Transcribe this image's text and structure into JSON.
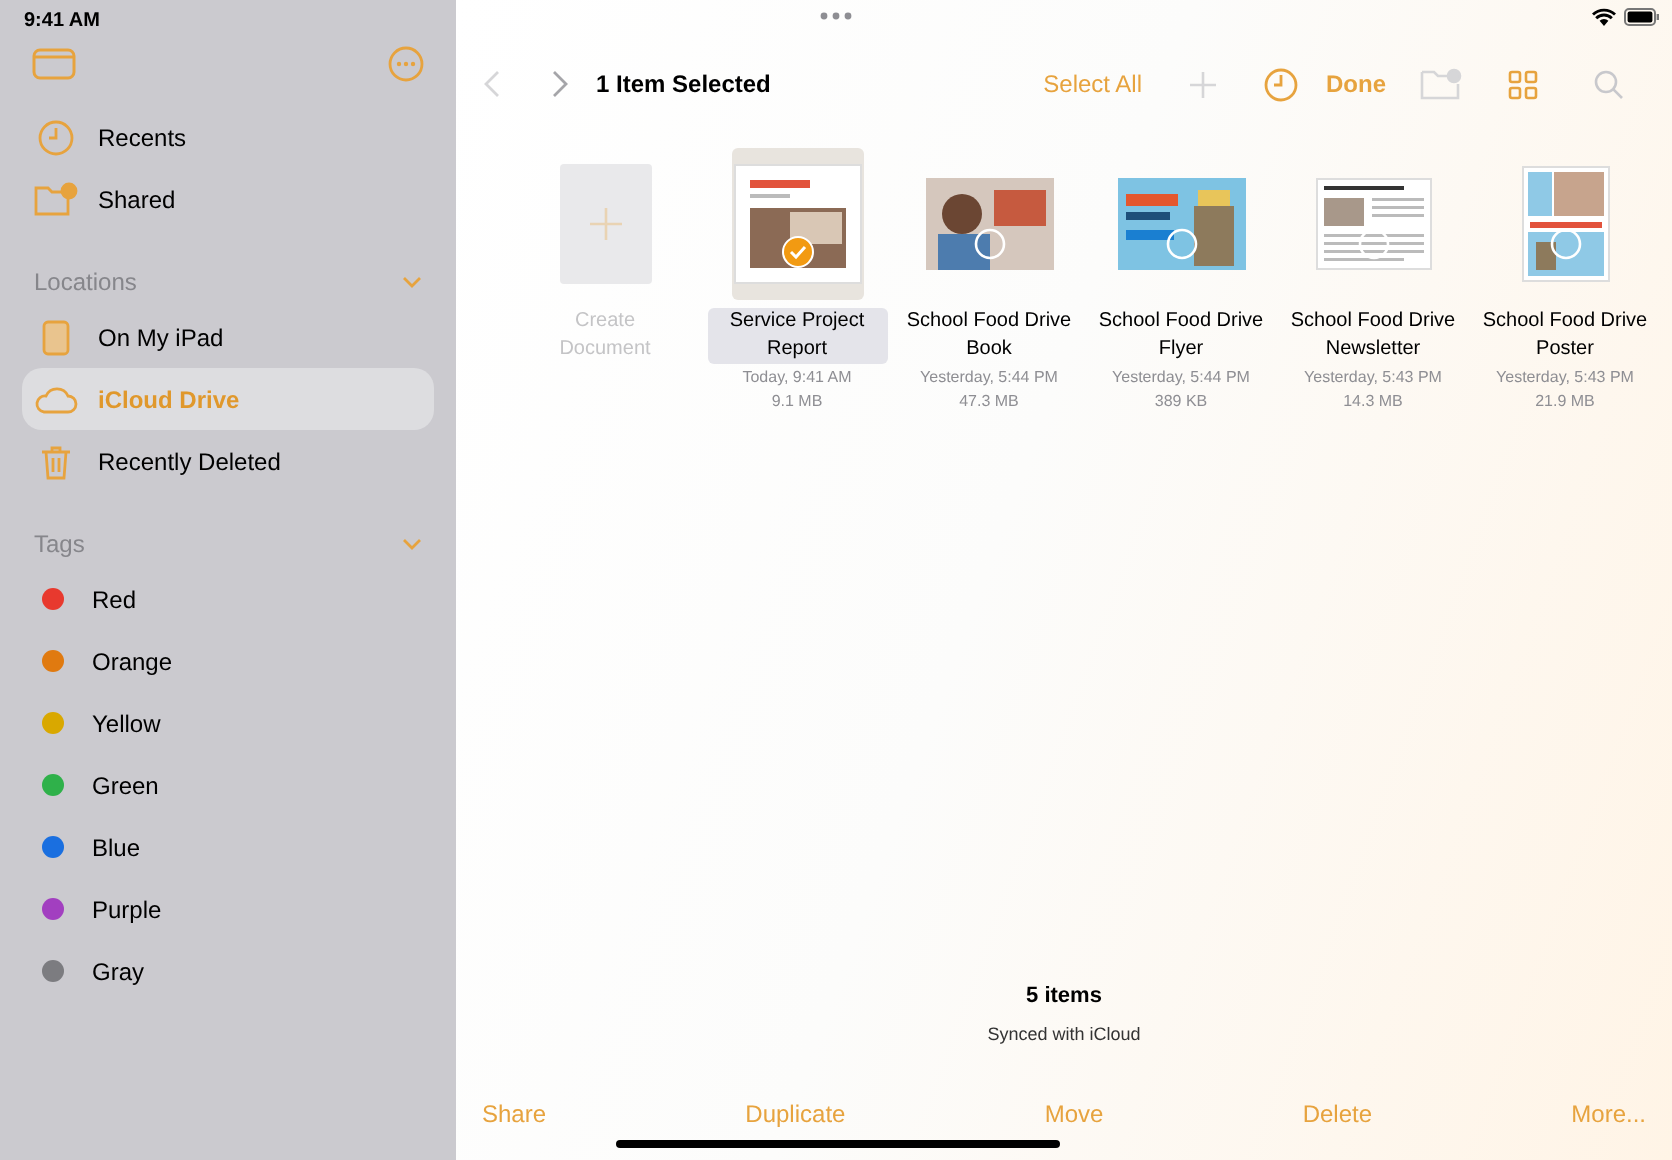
{
  "status_bar": {
    "time": "9:41 AM"
  },
  "sidebar": {
    "items": [
      {
        "label": "Recents",
        "selected": false
      },
      {
        "label": "Shared",
        "selected": false
      }
    ],
    "sections": [
      {
        "title": "Locations",
        "expanded": true,
        "items": [
          {
            "label": "On My iPad",
            "selected": false
          },
          {
            "label": "iCloud Drive",
            "selected": true
          },
          {
            "label": "Recently Deleted",
            "selected": false
          }
        ]
      },
      {
        "title": "Tags",
        "expanded": true,
        "items": [
          {
            "label": "Red",
            "color": "#e8392e",
            "selected": false
          },
          {
            "label": "Orange",
            "color": "#e07a10",
            "selected": false
          },
          {
            "label": "Yellow",
            "color": "#d9a800",
            "selected": false
          },
          {
            "label": "Green",
            "color": "#2fb14a",
            "selected": false
          },
          {
            "label": "Blue",
            "color": "#1a6fe0",
            "selected": false
          },
          {
            "label": "Purple",
            "color": "#a23fc0",
            "selected": false
          },
          {
            "label": "Gray",
            "color": "#7c7c80",
            "selected": false
          }
        ]
      }
    ]
  },
  "toolbar": {
    "title": "1 Item Selected",
    "back_enabled": false,
    "forward_enabled": false,
    "select_all": "Select All",
    "add_enabled": false,
    "done": "Done",
    "new_folder_enabled": false,
    "search_enabled": false
  },
  "files": [
    {
      "kind": "create",
      "name": "Create Document"
    },
    {
      "kind": "document",
      "name": "Service Project Report",
      "date": "Today, 9:41 AM",
      "size": "9.1 MB",
      "selected": true
    },
    {
      "kind": "document",
      "name": "School Food Drive Book",
      "date": "Yesterday, 5:44 PM",
      "size": "47.3 MB",
      "selected": false
    },
    {
      "kind": "document",
      "name": "School Food Drive Flyer",
      "date": "Yesterday, 5:44 PM",
      "size": "389 KB",
      "selected": false
    },
    {
      "kind": "document",
      "name": "School Food Drive Newsletter",
      "date": "Yesterday, 5:43 PM",
      "size": "14.3 MB",
      "selected": false
    },
    {
      "kind": "document",
      "name": "School Food Drive Poster",
      "date": "Yesterday, 5:43 PM",
      "size": "21.9 MB",
      "selected": false
    }
  ],
  "footer": {
    "count": "5 items",
    "sync": "Synced with iCloud"
  },
  "actions": [
    "Share",
    "Duplicate",
    "Move",
    "Delete",
    "More..."
  ]
}
